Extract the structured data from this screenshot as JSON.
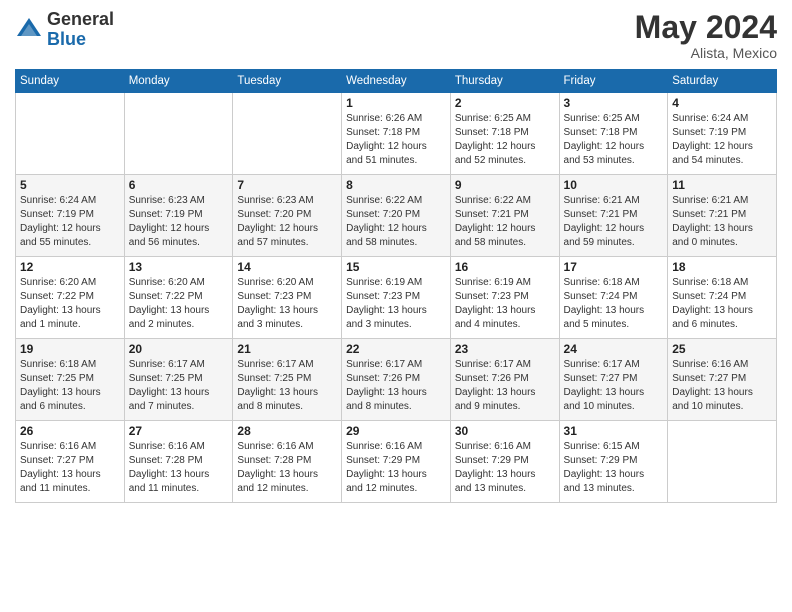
{
  "logo": {
    "general": "General",
    "blue": "Blue"
  },
  "title": "May 2024",
  "location": "Alista, Mexico",
  "days_of_week": [
    "Sunday",
    "Monday",
    "Tuesday",
    "Wednesday",
    "Thursday",
    "Friday",
    "Saturday"
  ],
  "weeks": [
    [
      {
        "day": "",
        "info": ""
      },
      {
        "day": "",
        "info": ""
      },
      {
        "day": "",
        "info": ""
      },
      {
        "day": "1",
        "info": "Sunrise: 6:26 AM\nSunset: 7:18 PM\nDaylight: 12 hours\nand 51 minutes."
      },
      {
        "day": "2",
        "info": "Sunrise: 6:25 AM\nSunset: 7:18 PM\nDaylight: 12 hours\nand 52 minutes."
      },
      {
        "day": "3",
        "info": "Sunrise: 6:25 AM\nSunset: 7:18 PM\nDaylight: 12 hours\nand 53 minutes."
      },
      {
        "day": "4",
        "info": "Sunrise: 6:24 AM\nSunset: 7:19 PM\nDaylight: 12 hours\nand 54 minutes."
      }
    ],
    [
      {
        "day": "5",
        "info": "Sunrise: 6:24 AM\nSunset: 7:19 PM\nDaylight: 12 hours\nand 55 minutes."
      },
      {
        "day": "6",
        "info": "Sunrise: 6:23 AM\nSunset: 7:19 PM\nDaylight: 12 hours\nand 56 minutes."
      },
      {
        "day": "7",
        "info": "Sunrise: 6:23 AM\nSunset: 7:20 PM\nDaylight: 12 hours\nand 57 minutes."
      },
      {
        "day": "8",
        "info": "Sunrise: 6:22 AM\nSunset: 7:20 PM\nDaylight: 12 hours\nand 58 minutes."
      },
      {
        "day": "9",
        "info": "Sunrise: 6:22 AM\nSunset: 7:21 PM\nDaylight: 12 hours\nand 58 minutes."
      },
      {
        "day": "10",
        "info": "Sunrise: 6:21 AM\nSunset: 7:21 PM\nDaylight: 12 hours\nand 59 minutes."
      },
      {
        "day": "11",
        "info": "Sunrise: 6:21 AM\nSunset: 7:21 PM\nDaylight: 13 hours\nand 0 minutes."
      }
    ],
    [
      {
        "day": "12",
        "info": "Sunrise: 6:20 AM\nSunset: 7:22 PM\nDaylight: 13 hours\nand 1 minute."
      },
      {
        "day": "13",
        "info": "Sunrise: 6:20 AM\nSunset: 7:22 PM\nDaylight: 13 hours\nand 2 minutes."
      },
      {
        "day": "14",
        "info": "Sunrise: 6:20 AM\nSunset: 7:23 PM\nDaylight: 13 hours\nand 3 minutes."
      },
      {
        "day": "15",
        "info": "Sunrise: 6:19 AM\nSunset: 7:23 PM\nDaylight: 13 hours\nand 3 minutes."
      },
      {
        "day": "16",
        "info": "Sunrise: 6:19 AM\nSunset: 7:23 PM\nDaylight: 13 hours\nand 4 minutes."
      },
      {
        "day": "17",
        "info": "Sunrise: 6:18 AM\nSunset: 7:24 PM\nDaylight: 13 hours\nand 5 minutes."
      },
      {
        "day": "18",
        "info": "Sunrise: 6:18 AM\nSunset: 7:24 PM\nDaylight: 13 hours\nand 6 minutes."
      }
    ],
    [
      {
        "day": "19",
        "info": "Sunrise: 6:18 AM\nSunset: 7:25 PM\nDaylight: 13 hours\nand 6 minutes."
      },
      {
        "day": "20",
        "info": "Sunrise: 6:17 AM\nSunset: 7:25 PM\nDaylight: 13 hours\nand 7 minutes."
      },
      {
        "day": "21",
        "info": "Sunrise: 6:17 AM\nSunset: 7:25 PM\nDaylight: 13 hours\nand 8 minutes."
      },
      {
        "day": "22",
        "info": "Sunrise: 6:17 AM\nSunset: 7:26 PM\nDaylight: 13 hours\nand 8 minutes."
      },
      {
        "day": "23",
        "info": "Sunrise: 6:17 AM\nSunset: 7:26 PM\nDaylight: 13 hours\nand 9 minutes."
      },
      {
        "day": "24",
        "info": "Sunrise: 6:17 AM\nSunset: 7:27 PM\nDaylight: 13 hours\nand 10 minutes."
      },
      {
        "day": "25",
        "info": "Sunrise: 6:16 AM\nSunset: 7:27 PM\nDaylight: 13 hours\nand 10 minutes."
      }
    ],
    [
      {
        "day": "26",
        "info": "Sunrise: 6:16 AM\nSunset: 7:27 PM\nDaylight: 13 hours\nand 11 minutes."
      },
      {
        "day": "27",
        "info": "Sunrise: 6:16 AM\nSunset: 7:28 PM\nDaylight: 13 hours\nand 11 minutes."
      },
      {
        "day": "28",
        "info": "Sunrise: 6:16 AM\nSunset: 7:28 PM\nDaylight: 13 hours\nand 12 minutes."
      },
      {
        "day": "29",
        "info": "Sunrise: 6:16 AM\nSunset: 7:29 PM\nDaylight: 13 hours\nand 12 minutes."
      },
      {
        "day": "30",
        "info": "Sunrise: 6:16 AM\nSunset: 7:29 PM\nDaylight: 13 hours\nand 13 minutes."
      },
      {
        "day": "31",
        "info": "Sunrise: 6:15 AM\nSunset: 7:29 PM\nDaylight: 13 hours\nand 13 minutes."
      },
      {
        "day": "",
        "info": ""
      }
    ]
  ]
}
